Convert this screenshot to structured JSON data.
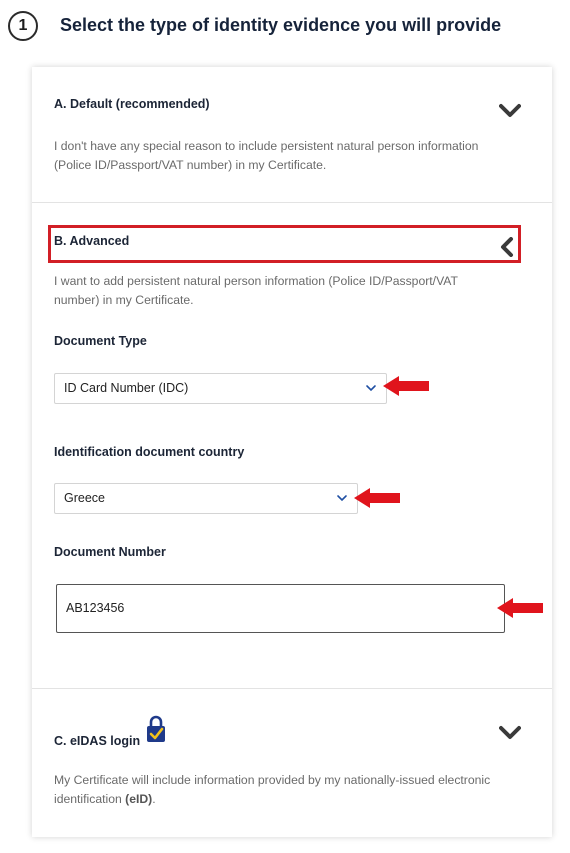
{
  "step": {
    "number": "1",
    "title": "Select the type of identity evidence you will provide"
  },
  "options": {
    "a": {
      "title": "A. Default (recommended)",
      "description": "I don't have any special reason to include persistent natural person information (Police ID/Passport/VAT number) in my Certificate.",
      "expanded": false,
      "icon": "chevron-down-icon"
    },
    "b": {
      "title": "B. Advanced",
      "description": "I want to add persistent natural person information (Police ID/Passport/VAT number) in my Certificate.",
      "expanded": true,
      "icon": "chevron-left-icon"
    },
    "c": {
      "title": "C. eIDAS login",
      "description_before": "My Certificate will include information provided by my nationally-issued electronic identification ",
      "description_bold": "(eID)",
      "description_after": ".",
      "expanded": false,
      "icon": "chevron-down-icon",
      "badge_icon": "lock-check-icon"
    }
  },
  "form": {
    "document_type": {
      "label": "Document Type",
      "value": "ID Card Number (IDC)"
    },
    "country": {
      "label": "Identification document country",
      "value": "Greece"
    },
    "document_number": {
      "label": "Document Number",
      "value": "AB123456"
    }
  },
  "annotations": {
    "highlight_color": "#d21f26",
    "arrow_color": "#e0141c"
  },
  "colors": {
    "title": "#16233a",
    "description": "#6a6a6a",
    "accent_blue": "#1f4fa3"
  }
}
